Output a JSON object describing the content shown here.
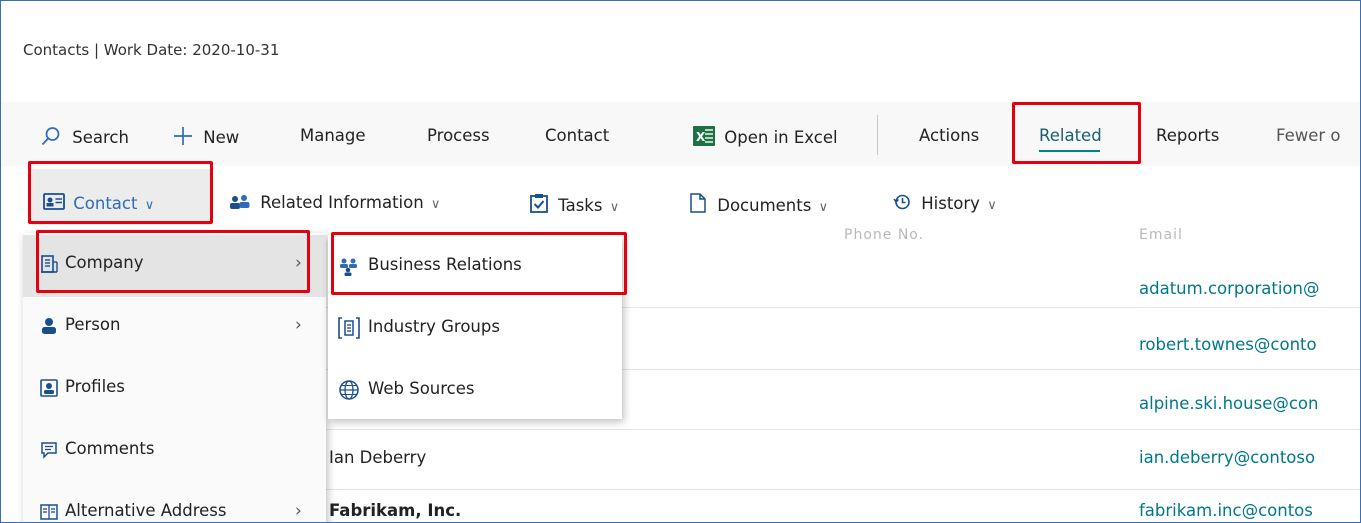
{
  "header": {
    "title": "Contacts | Work Date: 2020-10-31"
  },
  "actionbar": {
    "search": "Search",
    "new": "New",
    "manage": "Manage",
    "process": "Process",
    "contact": "Contact",
    "open_in_excel": "Open in Excel",
    "actions": "Actions",
    "related": "Related",
    "reports": "Reports",
    "fewer": "Fewer o"
  },
  "subbar": {
    "contact": "Contact",
    "related_information": "Related Information",
    "tasks": "Tasks",
    "documents": "Documents",
    "history": "History"
  },
  "list": {
    "header_ghost_1": "Phone No.",
    "header_ghost_2": "Email",
    "rows": [
      {
        "name": "",
        "email": "adatum.corporation@"
      },
      {
        "name": "",
        "email": "robert.townes@conto"
      },
      {
        "name": "",
        "email": "alpine.ski.house@con"
      },
      {
        "name": "Ian Deberry",
        "email": "ian.deberry@contoso"
      },
      {
        "name": "Fabrikam, Inc.",
        "email": "fabrikam.inc@contos"
      }
    ]
  },
  "menu_contact": {
    "items": [
      {
        "label": "Company",
        "icon": "company-icon",
        "submenu": true
      },
      {
        "label": "Person",
        "icon": "person-icon",
        "submenu": true
      },
      {
        "label": "Profiles",
        "icon": "profiles-icon",
        "submenu": false
      },
      {
        "label": "Comments",
        "icon": "comments-icon",
        "submenu": false
      },
      {
        "label": "Alternative Address",
        "icon": "address-icon",
        "submenu": true
      }
    ]
  },
  "menu_company": {
    "items": [
      {
        "label": "Business Relations",
        "icon": "business-relations-icon"
      },
      {
        "label": "Industry Groups",
        "icon": "industry-groups-icon"
      },
      {
        "label": "Web Sources",
        "icon": "globe-icon"
      }
    ]
  },
  "colors": {
    "accent": "#00847e",
    "link": "#00788a",
    "highlight": "#e3000f",
    "excel": "#1e7145"
  }
}
